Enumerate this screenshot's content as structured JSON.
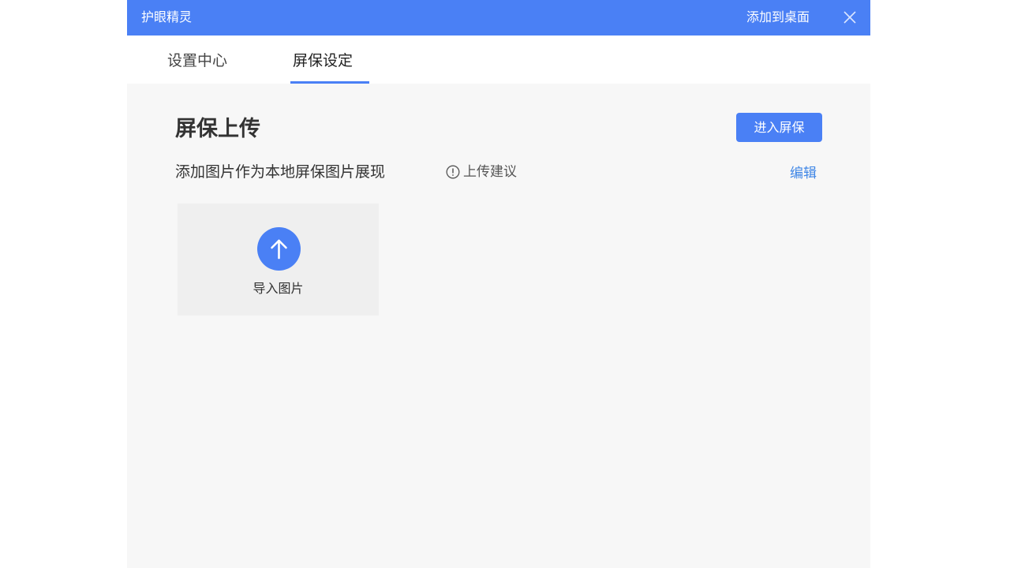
{
  "window": {
    "title": "护眼精灵",
    "add_to_desktop": "添加到桌面",
    "close_icon": "close-icon"
  },
  "tabs": [
    {
      "label": "设置中心",
      "active": false
    },
    {
      "label": "屏保设定",
      "active": true
    }
  ],
  "main": {
    "section_title": "屏保上传",
    "enter_button": "进入屏保",
    "description": "添加图片作为本地屏保图片展现",
    "upload_tip": "上传建议",
    "tip_icon": "info-icon",
    "edit_link": "编辑",
    "upload_tile": {
      "icon": "upload-arrow-icon",
      "label": "导入图片"
    }
  },
  "colors": {
    "accent": "#4a80f5",
    "link": "#3f86e6",
    "content_bg": "#f7f7f7",
    "tile_bg": "#efefef"
  }
}
